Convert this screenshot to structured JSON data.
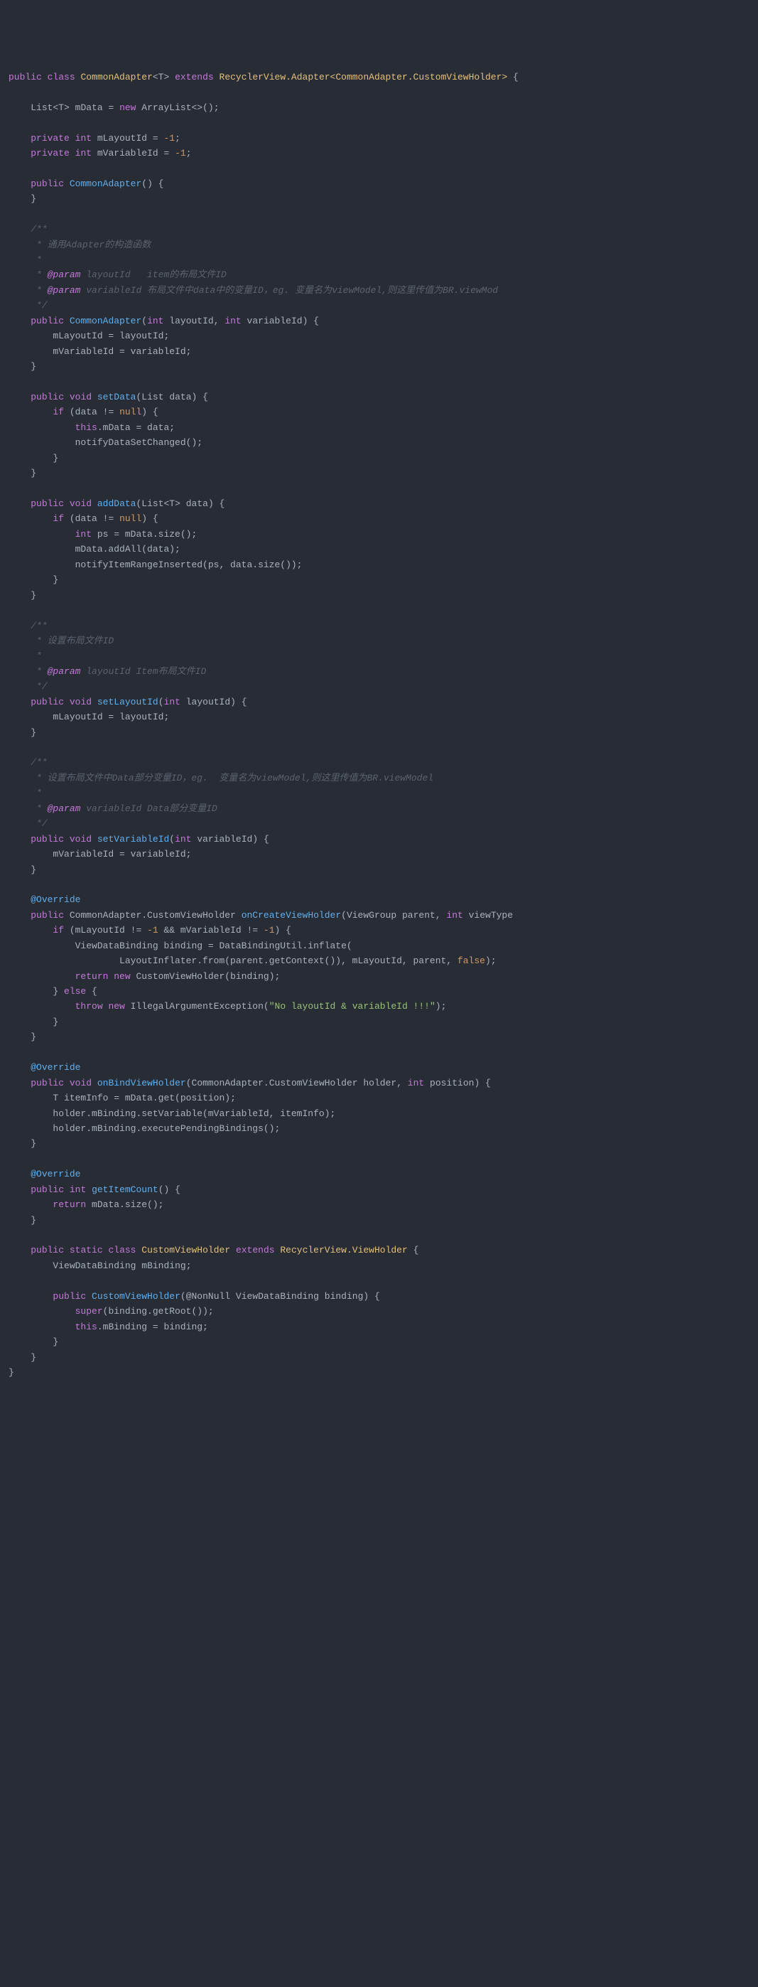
{
  "code": {
    "class_decl": {
      "kw_public": "public",
      "kw_class": "class",
      "name": "CommonAdapter",
      "generic": "<T>",
      "kw_extends": "extends",
      "super": "RecyclerView.Adapter<CommonAdapter.CustomViewHolder>"
    },
    "field_mData": {
      "type": "List<T>",
      "name": "mData",
      "kw_new": "new",
      "init": "ArrayList<>()"
    },
    "field_mLayoutId": {
      "kw_private": "private",
      "kw_int": "int",
      "name": "mLayoutId",
      "val": "-1"
    },
    "field_mVariableId": {
      "kw_private": "private",
      "kw_int": "int",
      "name": "mVariableId",
      "val": "-1"
    },
    "ctor0": {
      "kw_public": "public",
      "name": "CommonAdapter"
    },
    "doc_ctor1": {
      "l1": "/**",
      "l2": " * 通用Adapter的构造函数",
      "l3": " *",
      "l4a": " * ",
      "l4tag": "@param",
      "l4b": " layoutId   item的布局文件ID",
      "l5a": " * ",
      "l5tag": "@param",
      "l5b": " variableId 布局文件中data中的变量ID，eg. 变量名为viewModel,则这里传值为BR.viewMod",
      "l6": " */"
    },
    "ctor1": {
      "kw_public": "public",
      "name": "CommonAdapter",
      "kw_int": "int",
      "p1": "layoutId",
      "p2": "variableId",
      "body1": "mLayoutId = layoutId;",
      "body2": "mVariableId = variableId;"
    },
    "setData": {
      "kw_public": "public",
      "kw_void": "void",
      "name": "setData",
      "ptype": "List",
      "pname": "data",
      "kw_if": "if",
      "cond_a": "(data != ",
      "cond_null": "null",
      "cond_b": ") {",
      "kw_this": "this",
      "l1": ".mData = data;",
      "l2": "notifyDataSetChanged();"
    },
    "addData": {
      "kw_public": "public",
      "kw_void": "void",
      "name": "addData",
      "ptype": "List<T>",
      "pname": "data",
      "kw_if": "if",
      "cond_a": "(data != ",
      "cond_null": "null",
      "cond_b": ") {",
      "kw_int": "int",
      "l1": " ps = mData.size();",
      "l2": "mData.addAll(data);",
      "l3": "notifyItemRangeInserted(ps, data.size());"
    },
    "doc_setLayoutId": {
      "l1": "/**",
      "l2": " * 设置布局文件ID",
      "l3": " *",
      "l4a": " * ",
      "l4tag": "@param",
      "l4b": " layoutId Item布局文件ID",
      "l5": " */"
    },
    "setLayoutId": {
      "kw_public": "public",
      "kw_void": "void",
      "name": "setLayoutId",
      "kw_int": "int",
      "pname": "layoutId",
      "body": "mLayoutId = layoutId;"
    },
    "doc_setVariableId": {
      "l1": "/**",
      "l2": " * 设置布局文件中Data部分变量ID，eg.  变量名为viewModel,则这里传值为BR.viewModel",
      "l3": " *",
      "l4a": " * ",
      "l4tag": "@param",
      "l4b": " variableId Data部分变量ID",
      "l5": " */"
    },
    "setVariableId": {
      "kw_public": "public",
      "kw_void": "void",
      "name": "setVariableId",
      "kw_int": "int",
      "pname": "variableId",
      "body": "mVariableId = variableId;"
    },
    "override": "@Override",
    "onCreateVH": {
      "kw_public": "public",
      "rettype": "CommonAdapter.CustomViewHolder",
      "name": "onCreateViewHolder",
      "ptype1": "ViewGroup",
      "pname1": "parent",
      "kw_int": "int",
      "pname2": "viewType",
      "kw_if": "if",
      "cond": "(mLayoutId != -1 && mVariableId != -1) {",
      "cond_n1": "-1",
      "l1a": "ViewDataBinding binding = DataBindingUtil.inflate(",
      "l2a": "LayoutInflater.from(parent.getContext()), mLayoutId, parent, ",
      "false": "false",
      "l2b": ");",
      "kw_return": "return",
      "kw_new": "new",
      "l3": " CustomViewHolder(binding);",
      "kw_else": "else",
      "kw_throw": "throw",
      "exc": "IllegalArgumentException",
      "msg": "\"No layoutId & variableId !!!\""
    },
    "onBindVH": {
      "kw_public": "public",
      "kw_void": "void",
      "name": "onBindViewHolder",
      "ptype1": "CommonAdapter.CustomViewHolder",
      "pname1": "holder",
      "kw_int": "int",
      "pname2": "position",
      "l1a": "T itemInfo = mData.get(position);",
      "l2": "holder.mBinding.setVariable(mVariableId, itemInfo);",
      "l3": "holder.mBinding.executePendingBindings();"
    },
    "getItemCount": {
      "kw_public": "public",
      "kw_int": "int",
      "name": "getItemCount",
      "kw_return": "return",
      "body": " mData.size();"
    },
    "cvh": {
      "kw_public": "public",
      "kw_static": "static",
      "kw_class": "class",
      "name": "CustomViewHolder",
      "kw_extends": "extends",
      "super": "RecyclerView.ViewHolder",
      "ftype": "ViewDataBinding",
      "fname": "mBinding",
      "ctor_name": "CustomViewHolder",
      "ann": "@NonNull",
      "ptype": "ViewDataBinding",
      "pname": "binding",
      "kw_super": "super",
      "l1": "(binding.getRoot());",
      "kw_this": "this",
      "l2": ".mBinding = binding;"
    }
  }
}
